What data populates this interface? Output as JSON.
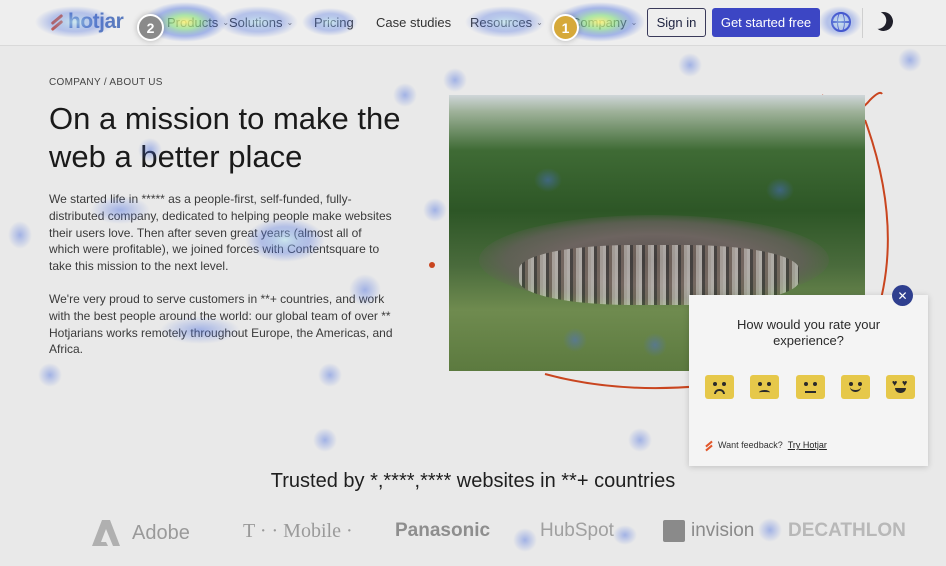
{
  "nav": {
    "logo_text": "hotjar",
    "items": [
      {
        "label": "Products",
        "chevron": true
      },
      {
        "label": "Solutions",
        "chevron": true
      },
      {
        "label": "Pricing",
        "chevron": false
      },
      {
        "label": "Case studies",
        "chevron": false
      },
      {
        "label": "Resources",
        "chevron": true
      },
      {
        "label": "Company",
        "chevron": true
      }
    ],
    "signin_label": "Sign in",
    "cta_label": "Get started free",
    "icons": [
      "globe-icon",
      "moon-icon"
    ]
  },
  "markers": [
    {
      "number": "2",
      "color": "#8a8a8a"
    },
    {
      "number": "1",
      "color": "#d6a93a"
    }
  ],
  "hero": {
    "breadcrumb": "COMPANY / ABOUT US",
    "title": "On a mission to make the web a better place",
    "paragraph_1": "We started life in ***** as a people-first, self-funded, fully-distributed company, dedicated to helping people make websites their users love. Then after seven great years (almost all of which were profitable), we joined forces with Contentsquare to take this mission to the next level.",
    "paragraph_2": "We're very proud to serve customers in **+ countries, and work with the best people around the world: our global team of over ** Hotjarians works remotely throughout Europe, the Americas, and Africa."
  },
  "feedback_widget": {
    "question": "How would you rate your experience?",
    "ratings": [
      "angry-face-icon",
      "sad-face-icon",
      "neutral-face-icon",
      "happy-face-icon",
      "love-face-icon"
    ],
    "footer_text": "Want feedback?",
    "footer_link": "Try Hotjar",
    "close_glyph": "✕"
  },
  "trusted": {
    "heading": "Trusted by *,****,**** websites in **+ countries",
    "brands": [
      "Adobe",
      "T · · Mobile ·",
      "Panasonic",
      "HubSpot",
      "invision",
      "DECATHLON"
    ]
  },
  "colors": {
    "accent": "#3c46c4",
    "brand_orange": "#e2572b",
    "rating_yellow": "#e6c84a"
  }
}
